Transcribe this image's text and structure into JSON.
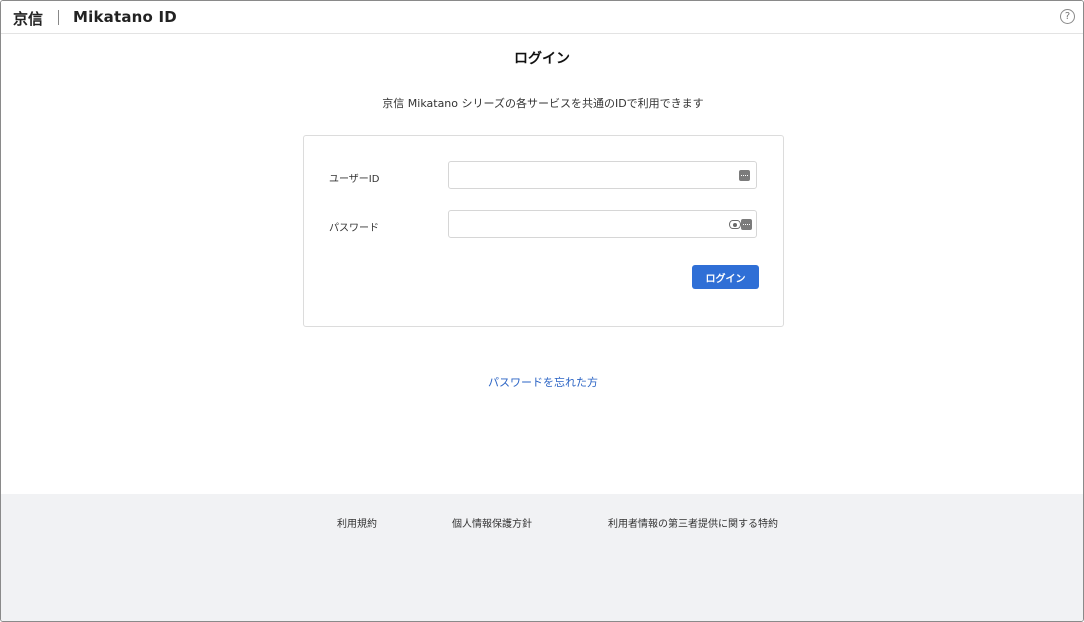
{
  "header": {
    "brand_kyoshin": "京信",
    "brand_mikatano_id": "Mikatano ID",
    "help_icon": "?"
  },
  "main": {
    "title": "ログイン",
    "subtitle": "京信 Mikatano シリーズの各サービスを共通のIDで利用できます"
  },
  "login_form": {
    "user_id_label": "ユーザーID",
    "user_id_value": "",
    "password_label": "パスワード",
    "password_value": "",
    "submit_label": "ログイン"
  },
  "forgot_password_link": "パスワードを忘れた方",
  "footer": {
    "links": [
      "利用規約",
      "個人情報保護方針",
      "利用者情報の第三者提供に関する特約"
    ]
  },
  "colors": {
    "accent": "#2f6fd6",
    "link": "#2a63c4",
    "footer_bg": "#f1f2f4"
  },
  "icons": {
    "help": "help-circle-icon",
    "password_manager": "keyboard-dots-icon",
    "reveal_password": "eye-icon"
  }
}
